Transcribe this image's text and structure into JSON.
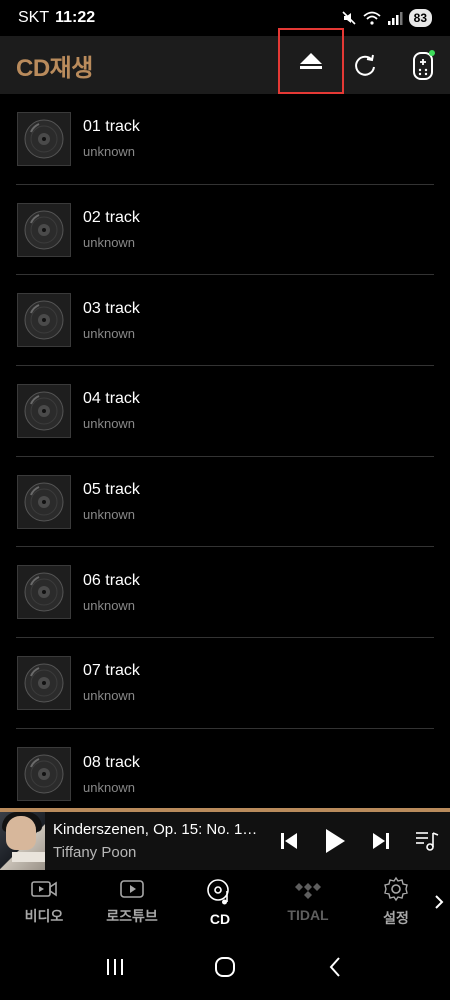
{
  "status_bar": {
    "carrier": "SKT",
    "time": "11:22",
    "battery": "83"
  },
  "header": {
    "title": "CD재생",
    "eject_icon": "eject-icon",
    "refresh_icon": "refresh-icon",
    "remote_icon": "remote-control-icon",
    "accent_color": "#b98b5c",
    "highlight_color": "#e53935"
  },
  "tracks": [
    {
      "title": "01 track",
      "artist": "unknown"
    },
    {
      "title": "02 track",
      "artist": "unknown"
    },
    {
      "title": "03 track",
      "artist": "unknown"
    },
    {
      "title": "04 track",
      "artist": "unknown"
    },
    {
      "title": "05 track",
      "artist": "unknown"
    },
    {
      "title": "06 track",
      "artist": "unknown"
    },
    {
      "title": "07 track",
      "artist": "unknown"
    },
    {
      "title": "08 track",
      "artist": "unknown"
    }
  ],
  "player": {
    "title": "Kinderszenen, Op. 15: No. 1, ...",
    "artist": "Tiffany Poon"
  },
  "bottom_nav": [
    {
      "label": "비디오",
      "icon": "video-icon"
    },
    {
      "label": "로즈튜브",
      "icon": "play-box-icon"
    },
    {
      "label": "CD",
      "icon": "cd-music-icon"
    },
    {
      "label": "TIDAL",
      "icon": "tidal-icon"
    },
    {
      "label": "설정",
      "icon": "gear-icon"
    }
  ]
}
